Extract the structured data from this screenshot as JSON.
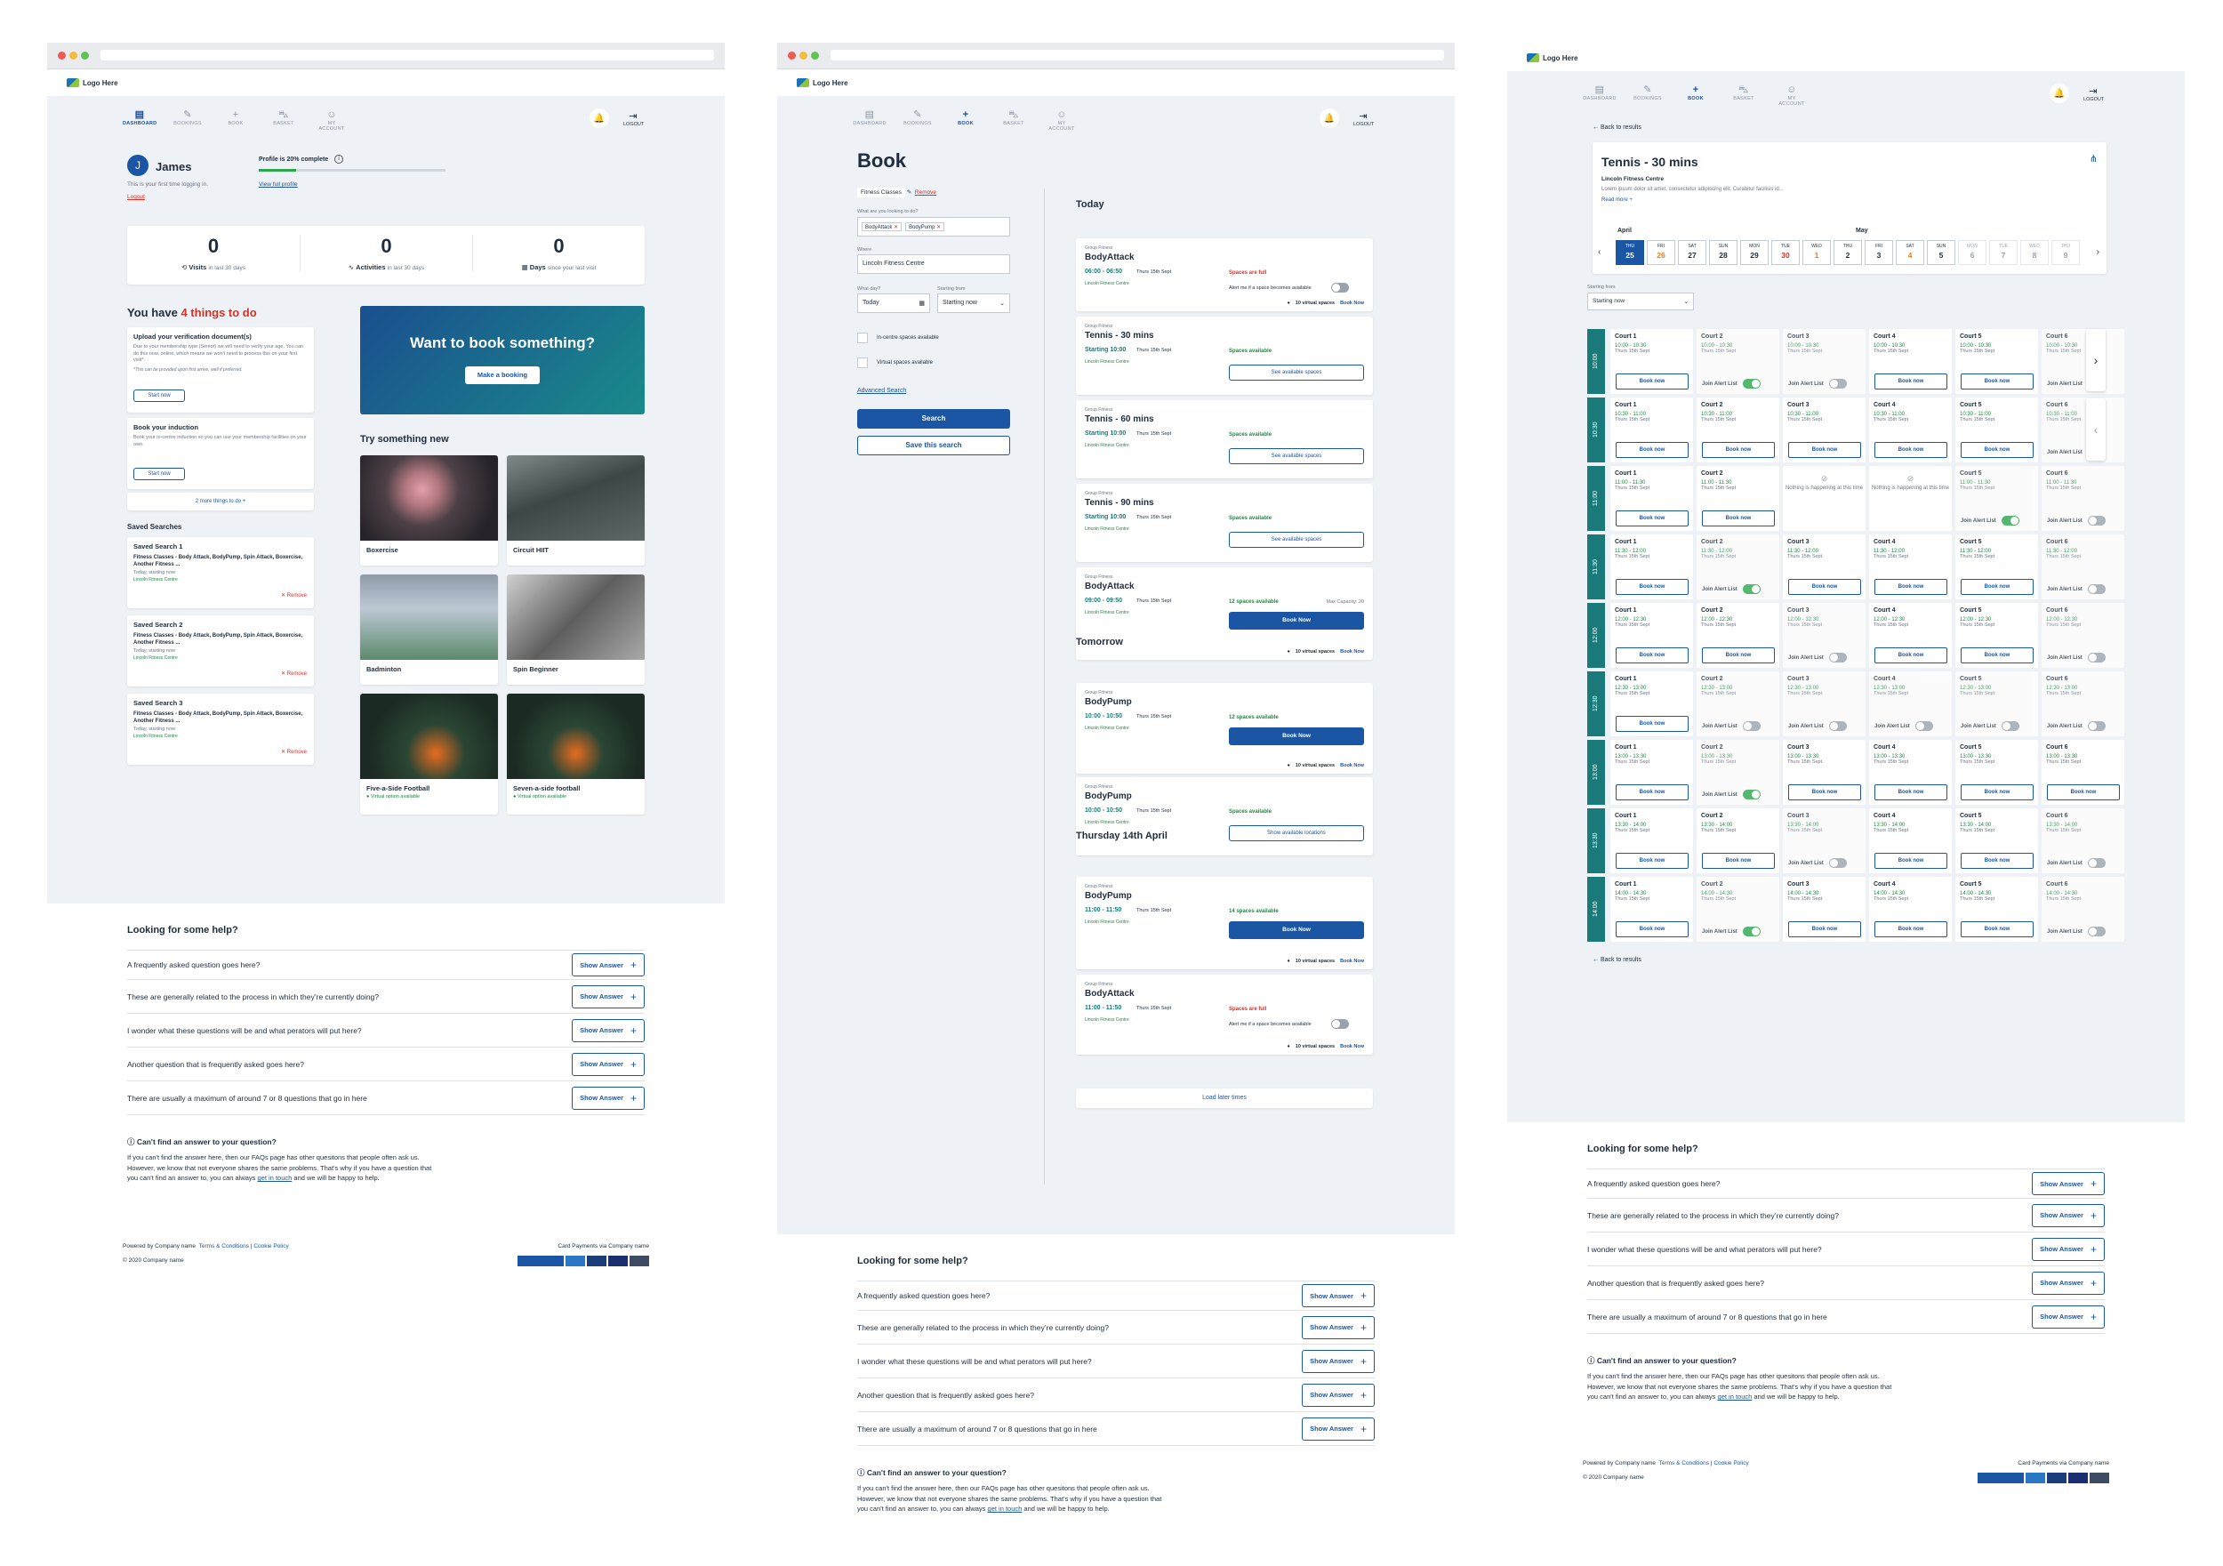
{
  "common": {
    "logo": "Logo Here",
    "nav": [
      "DASHBOARD",
      "BOOKINGS",
      "BOOK",
      "BASKET",
      "MY ACCOUNT"
    ],
    "logout": "LOGOUT",
    "faq_title": "Looking for some help?",
    "faqs": [
      "A frequently asked question goes here?",
      "These are generally related to the process in which they’re currently doing?",
      "I wonder what these questions will be and what perators will put here?",
      "Another question that is frequently asked goes here?",
      "There are usually a maximum of around 7 or 8 questions that go in here"
    ],
    "show_answer": "Show Answer",
    "cant_find": "Can't find an answer to your question?",
    "cant_find_text_1": "If you can't find the answer here, then our FAQs page has other quesitons that people often ask us.",
    "cant_find_text_2": "However, we know that not everyone shares the same problems. That's why if you have a question that",
    "cant_find_text_3a": "you can't find an answer to, you can always",
    "get_in_touch": "get in touch",
    "cant_find_text_3b": "and we will be happy to help.",
    "powered": "Powered by Company name",
    "terms": "Terms & Conditions",
    "cookie": "Cookie Policy",
    "copyright": "© 2020 Company name",
    "card_payments": "Card Payments via Company name"
  },
  "dashboard": {
    "name": "James",
    "initial": "J",
    "first_time": "This is your first time logging in.",
    "logout": "Logout",
    "profile_complete": "Profile is 20% complete",
    "profile_progress": 0.2,
    "view_profile": "View full profile",
    "stats": [
      {
        "value": "0",
        "label": "Visits",
        "sub": "in last 30 days"
      },
      {
        "value": "0",
        "label": "Activities",
        "sub": "in last 30 days"
      },
      {
        "value": "0",
        "label": "Days",
        "sub": "since your last visit"
      }
    ],
    "todo_prefix": "You have",
    "todo_count": "4 things to do",
    "todo1_title": "Upload your verification document(s)",
    "todo1_text": "Due to your membership type (Senior) we will need to verify your age. You can do this now, online, which means we won't need to process this on your first visit*.",
    "todo1_note": "*This can be provided upon first arrive, well if preferred.",
    "start_now": "Start now",
    "todo2_title": "Book your induction",
    "todo2_text": "Book your in-centre induction so you can use your membership facilities on your own.",
    "more_todo": "2 more things to do",
    "saved_title": "Saved Searches",
    "saved": [
      {
        "title": "Saved Search 1",
        "desc": "Fitness Classes - Body Attack, BodyPump, Spin Attack, Boxercise, Another Fitness ...",
        "when": "Today, starting now",
        "where": "Lincoln Fitness Centre"
      },
      {
        "title": "Saved Search 2",
        "desc": "Fitness Classes - Body Attack, BodyPump, Spin Attack, Boxercise, Another Fitness ...",
        "when": "Today, starting now",
        "where": "Lincoln Fitness Centre"
      },
      {
        "title": "Saved Search 3",
        "desc": "Fitness Classes - Body Attack, BodyPump, Spin Attack, Boxercise, Another Fitness ...",
        "when": "Today, starting now",
        "where": "Lincoln Fitness Centre"
      }
    ],
    "remove": "Remove",
    "promo_title": "Want to book something?",
    "promo_button": "Make a booking",
    "try_title": "Try something new",
    "activities": [
      {
        "name": "Boxercise",
        "note": ""
      },
      {
        "name": "Circuit HIIT",
        "note": ""
      },
      {
        "name": "Badminton",
        "note": ""
      },
      {
        "name": "Spin Beginner",
        "note": ""
      },
      {
        "name": "Five-a-Side Football",
        "note": "Virtual option available"
      },
      {
        "name": "Seven-a-side football",
        "note": "Virtual option available"
      }
    ]
  },
  "book": {
    "title": "Book",
    "filter_tag": "Fitness Classes",
    "remove": "Remove",
    "looking_label": "What are you looking to do?",
    "chips": [
      "BodyAttack",
      "BodyPump"
    ],
    "where_label": "Where",
    "where_value": "Lincoln Fitness Centre",
    "what_day_label": "What day?",
    "what_day_value": "Today",
    "starting_label": "Starting from",
    "starting_value": "Starting now",
    "in_centre": "In-centre spaces available",
    "virtual": "Virtual spaces available",
    "advanced": "Advanced Search",
    "search": "Search",
    "save_search": "Save this search",
    "groups": [
      {
        "day": "Today",
        "items": [
          {
            "cat": "Group Fitness",
            "name": "BodyAttack",
            "time": "06:00 - 06:50",
            "date": "Thurs 15th Sept",
            "loc": "Lincoln Fitness Centre",
            "status": "Spaces are full",
            "status_type": "full",
            "extra": "Alert me if a space becomes available",
            "virtual": "10 virtual spaces",
            "book": "Book Now"
          },
          {
            "cat": "Group Fitness",
            "name": "Tennis - 30 mins",
            "time": "Starting 10:00",
            "date": "Thurs 15th Sept",
            "loc": "Lincoln Fitness Centre",
            "status": "Spaces available",
            "status_type": "ok",
            "button": "See available spaces"
          },
          {
            "cat": "Group Fitness",
            "name": "Tennis - 60 mins",
            "time": "Starting 10:00",
            "date": "Thurs 15th Sept",
            "loc": "Lincoln Fitness Centre",
            "status": "Spaces available",
            "status_type": "ok",
            "button": "See available spaces"
          },
          {
            "cat": "Group Fitness",
            "name": "Tennis - 90 mins",
            "time": "Starting 10:00",
            "date": "Thurs 15th Sept",
            "loc": "Lincoln Fitness Centre",
            "status": "Spaces available",
            "status_type": "ok",
            "button": "See available spaces"
          },
          {
            "cat": "Group Fitness",
            "name": "BodyAttack",
            "time": "09:00 - 09:50",
            "date": "Thurs 15th Sept",
            "loc": "Lincoln Fitness Centre",
            "status": "12 spaces available",
            "status_type": "ok",
            "cap": "Max Capacity: 20",
            "primary": "Book Now",
            "virtual": "10 virtual spaces",
            "book": "Book Now"
          }
        ]
      },
      {
        "day": "Tomorrow",
        "items": [
          {
            "cat": "Group Fitness",
            "name": "BodyPump",
            "time": "10:00 - 10:50",
            "date": "Thurs 15th Sept",
            "loc": "Lincoln Fitness Centre",
            "status": "12 spaces available",
            "status_type": "ok",
            "primary": "Book Now",
            "virtual": "10 virtual spaces",
            "book": "Book Now"
          },
          {
            "cat": "Group Fitness",
            "name": "BodyPump",
            "time": "10:00 - 10:50",
            "date": "Thurs 15th Sept",
            "loc": "Lincoln Fitness Centre",
            "status": "Spaces available",
            "status_type": "ok",
            "button": "Show available locations"
          }
        ]
      },
      {
        "day": "Thursday 14th April",
        "items": [
          {
            "cat": "Group Fitness",
            "name": "BodyPump",
            "time": "11:00 - 11:50",
            "date": "Thurs 15th Sept",
            "loc": "Lincoln Fitness Centre",
            "status": "14 spaces available",
            "status_type": "ok",
            "primary": "Book Now",
            "virtual": "10 virtual spaces",
            "book": "Book Now"
          },
          {
            "cat": "Group Fitness",
            "name": "BodyAttack",
            "time": "11:00 - 11:50",
            "date": "Thurs 15th Sept",
            "loc": "Lincoln Fitness Centre",
            "status": "Spaces are full",
            "status_type": "full",
            "extra": "Alert me if a space becomes available",
            "virtual": "10 virtual spaces",
            "book": "Book Now"
          }
        ]
      }
    ],
    "load_later": "Load later times"
  },
  "tennis": {
    "back": "Back to results",
    "title": "Tennis - 30 mins",
    "venue": "Lincoln Fitness Centre",
    "desc": "Lorem ipsum dolor sit amet, consectetur adipiscing elit. Curabitur facilisis id...",
    "read_more": "Read more",
    "month1": "April",
    "month2": "May",
    "days": [
      {
        "d": "THU",
        "n": "25",
        "state": "sel"
      },
      {
        "d": "FRI",
        "n": "26",
        "state": "orange"
      },
      {
        "d": "SAT",
        "n": "27",
        "state": ""
      },
      {
        "d": "SUN",
        "n": "28",
        "state": ""
      },
      {
        "d": "MON",
        "n": "29",
        "state": ""
      },
      {
        "d": "TUE",
        "n": "30",
        "state": "red"
      },
      {
        "d": "WED",
        "n": "1",
        "state": "orange"
      },
      {
        "d": "THU",
        "n": "2",
        "state": ""
      },
      {
        "d": "FRI",
        "n": "3",
        "state": ""
      },
      {
        "d": "SAT",
        "n": "4",
        "state": "orange"
      },
      {
        "d": "SUN",
        "n": "5",
        "state": ""
      },
      {
        "d": "MON",
        "n": "6",
        "state": "dim"
      },
      {
        "d": "TUE",
        "n": "7",
        "state": "dim"
      },
      {
        "d": "WED",
        "n": "8",
        "state": "dim"
      },
      {
        "d": "THU",
        "n": "9",
        "state": "dim"
      }
    ],
    "starting_label": "Starting from",
    "starting_value": "Starting now",
    "times": [
      "10:00",
      "10:30",
      "11:00",
      "11:30",
      "12:00",
      "12:30",
      "13:00",
      "13:30",
      "14:00"
    ],
    "slot_times": [
      "10:00 - 10:30",
      "10:30 - 11:00",
      "11:00 - 11:30",
      "11:30 - 12:00",
      "12:00 - 12:30",
      "12:30 - 13:00",
      "13:00 - 13:30",
      "13:30 - 14:00",
      "14:00 - 14:30"
    ],
    "slot_date": "Thurs 15th Sept",
    "courts": [
      "Court 1",
      "Court 2",
      "Court 3",
      "Court 4",
      "Court 5",
      "Court 6"
    ],
    "book_now": "Book now",
    "join_alert": "Join Alert List",
    "nothing": "Nothing is happening at this time",
    "grid": [
      [
        "b",
        "a1",
        "a0",
        "b",
        "b",
        "a"
      ],
      [
        "b",
        "b",
        "b",
        "b",
        "b",
        "a"
      ],
      [
        "b",
        "b",
        "n",
        "n",
        "a1",
        "a"
      ],
      [
        "b",
        "a1",
        "b",
        "b",
        "b",
        "a"
      ],
      [
        "b",
        "b",
        "a0",
        "b",
        "b",
        "a"
      ],
      [
        "b",
        "a0",
        "a0",
        "a0",
        "a0",
        "a"
      ],
      [
        "b",
        "a1",
        "b",
        "b",
        "b",
        "b"
      ],
      [
        "b",
        "b",
        "a0",
        "b",
        "b",
        "a"
      ],
      [
        "b",
        "a1",
        "b",
        "b",
        "b",
        "a"
      ]
    ]
  }
}
